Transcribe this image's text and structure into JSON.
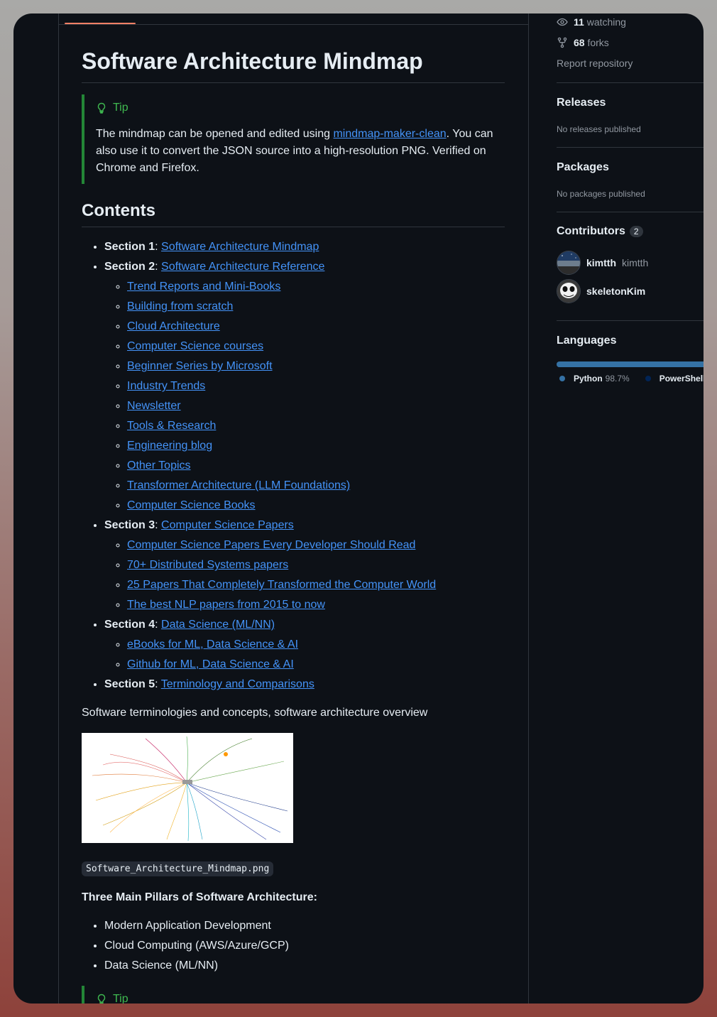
{
  "readme": {
    "title": "Software Architecture Mindmap",
    "tip1": {
      "label": "Tip",
      "text_before": "The mindmap can be opened and edited using ",
      "link": "mindmap-maker-clean",
      "text_after": ". You can also use it to convert the JSON source into a high-resolution PNG. Verified on Chrome and Firefox."
    },
    "contents_heading": "Contents",
    "sections": [
      {
        "label": "Section 1",
        "sep": ": ",
        "link": "Software Architecture Mindmap",
        "items": []
      },
      {
        "label": "Section 2",
        "sep": ": ",
        "link": "Software Architecture Reference",
        "items": [
          "Trend Reports and Mini-Books",
          "Building from scratch",
          "Cloud Architecture",
          "Computer Science courses",
          "Beginner Series by Microsoft",
          "Industry Trends",
          "Newsletter",
          "Tools & Research",
          "Engineering blog",
          "Other Topics",
          "Transformer Architecture (LLM Foundations)",
          "Computer Science Books"
        ]
      },
      {
        "label": "Section 3",
        "sep": ": ",
        "link": "Computer Science Papers",
        "items": [
          "Computer Science Papers Every Developer Should Read",
          "70+ Distributed Systems papers",
          "25 Papers That Completely Transformed the Computer World",
          "The best NLP papers from 2015 to now"
        ]
      },
      {
        "label": "Section 4",
        "sep": ": ",
        "link": "Data Science (ML/NN)",
        "items": [
          "eBooks for ML, Data Science & AI",
          "Github for ML, Data Science & AI"
        ]
      },
      {
        "label": "Section 5",
        "sep": ": ",
        "link": "Terminology and Comparisons",
        "items": []
      }
    ],
    "description": "Software terminologies and concepts, software architecture overview",
    "image_caption": "Software_Architecture_Mindmap.png",
    "pillars_title": "Three Main Pillars of Software Architecture:",
    "pillars": [
      "Modern Application Development",
      "Cloud Computing (AWS/Azure/GCP)",
      "Data Science (ML/NN)"
    ],
    "tip2_label": "Tip"
  },
  "sidebar": {
    "watching_count": "11",
    "watching_label": "watching",
    "forks_count": "68",
    "forks_label": "forks",
    "report": "Report repository",
    "releases_title": "Releases",
    "releases_empty": "No releases published",
    "packages_title": "Packages",
    "packages_empty": "No packages published",
    "contributors_title": "Contributors",
    "contributors_count": "2",
    "contributors": [
      {
        "name": "kimtth",
        "login": "kimtth"
      },
      {
        "name": "skeletonKim",
        "login": ""
      }
    ],
    "languages_title": "Languages",
    "languages": [
      {
        "name": "Python",
        "pct": "98.7%",
        "color": "#3572a5",
        "share": 0.987
      },
      {
        "name": "PowerShell",
        "pct": "",
        "color": "#012456",
        "share": 0.013
      }
    ]
  },
  "colors": {
    "accent": "#4493f8",
    "tip": "#3fb950",
    "background": "#0d1117",
    "tab_underline": "#f78166"
  }
}
